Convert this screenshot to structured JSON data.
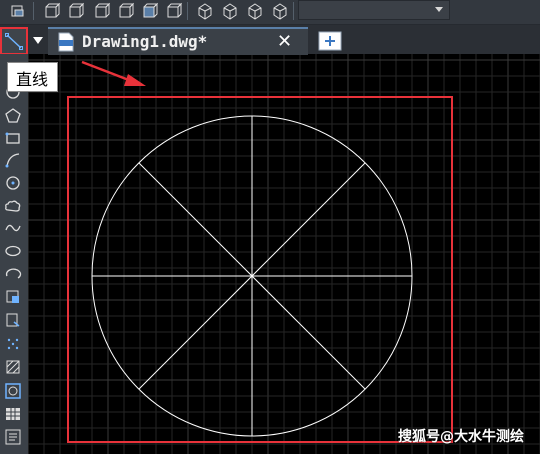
{
  "tab": {
    "title": "Drawing1.dwg*",
    "close_glyph": "✕",
    "new_glyph": "+"
  },
  "tooltip": {
    "text": "直线"
  },
  "watermark": {
    "text": "搜狐号@大水牛测绘"
  },
  "toolbar": {
    "icons": [
      "layout-icon",
      "box-view-icon",
      "box-view-icon",
      "box-view-icon",
      "box-view-icon",
      "box-view-icon",
      "box-view-icon",
      "box-view-icon",
      "visual-style-icon",
      "visual-style-icon",
      "visual-style-icon",
      "visual-style-icon"
    ],
    "dropdown_value": ""
  },
  "palette": {
    "icons": [
      "circle-icon",
      "polygon-icon",
      "rectangle-icon",
      "arc-icon",
      "circle-icon",
      "revision-cloud-icon",
      "spline-icon",
      "ellipse-icon",
      "ellipse-arc-icon",
      "insert-block-icon",
      "make-block-icon",
      "point-icon",
      "hatch-icon",
      "gradient-icon",
      "boundary-icon",
      "table-icon",
      "multiline-text-icon"
    ]
  },
  "colors": {
    "background": "#000000",
    "grid": "#262626",
    "grid_major": "#3a3a3a",
    "highlight": "#e8323a",
    "geometry": "#ffffff",
    "tab_accent": "#5a7fa8"
  }
}
